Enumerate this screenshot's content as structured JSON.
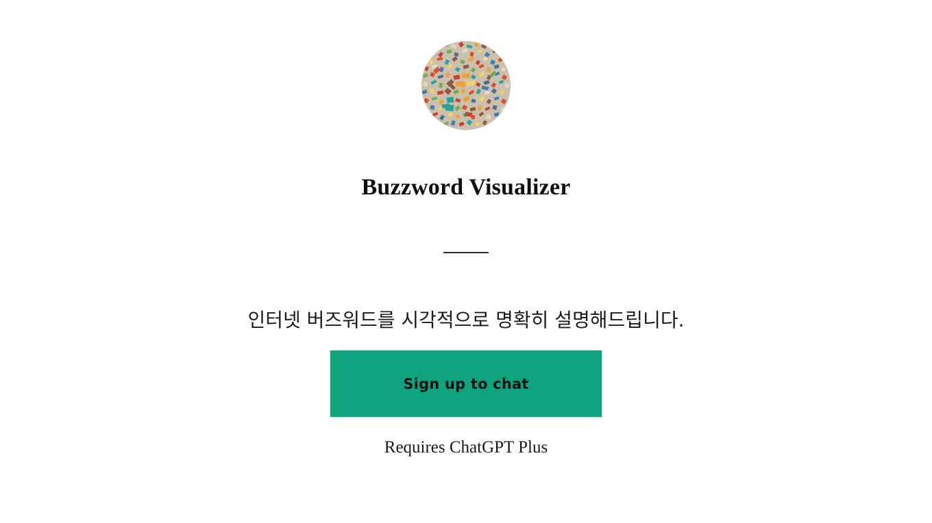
{
  "page": {
    "background_color": "#ffffff"
  },
  "gpt": {
    "avatar": {
      "icon": "mosaic-confetti-avatar",
      "shape": "circle",
      "palette": [
        "#d94f2a",
        "#e8a33d",
        "#f2d06b",
        "#3f7fae",
        "#2aa49a",
        "#6fae4b",
        "#e3d9c4",
        "#8e5b3f",
        "#c4452f",
        "#4a6f8c"
      ]
    },
    "title": "Buzzword Visualizer",
    "divider": "horizontal-rule",
    "subtitle": "인터넷 버즈워드를 시각적으로 명확히 설명해드립니다.",
    "cta": {
      "label": "Sign up to chat",
      "background_color": "#10a37f",
      "text_color": "#0d1410"
    },
    "footer_note": "Requires ChatGPT Plus"
  }
}
